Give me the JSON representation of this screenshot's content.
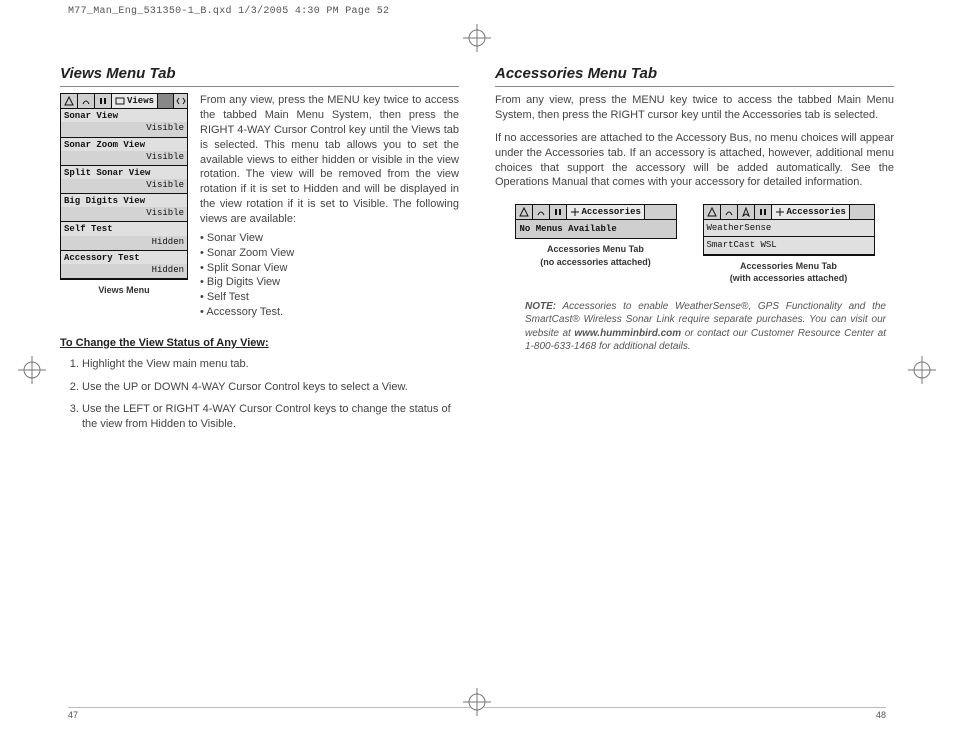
{
  "print_header": "M77_Man_Eng_531350-1_B.qxd  1/3/2005  4:30 PM  Page 52",
  "page_left": "47",
  "page_right": "48",
  "views": {
    "title": "Views Menu Tab",
    "para": "From any view, press the MENU key twice to access the tabbed Main Menu System, then press the RIGHT 4-WAY Cursor Control key until the Views tab is selected. This menu tab allows you to set the available views to either hidden or visible in the view rotation. The view will be removed from the view rotation if it is set to Hidden and will be displayed in the view rotation if it is set to Visible. The following views are available:",
    "list": [
      "Sonar View",
      "Sonar Zoom View",
      "Split Sonar View",
      "Big Digits View",
      "Self Test",
      "Accessory Test."
    ],
    "fig_caption": "Views Menu",
    "fig_tab_label": "Views",
    "fig_rows": [
      {
        "name": "Sonar View",
        "val": "Visible"
      },
      {
        "name": "Sonar Zoom View",
        "val": "Visible"
      },
      {
        "name": "Split Sonar View",
        "val": "Visible"
      },
      {
        "name": "Big Digits View",
        "val": "Visible"
      },
      {
        "name": "Self Test",
        "val": "Hidden"
      },
      {
        "name": "Accessory Test",
        "val": "Hidden"
      }
    ],
    "change_heading": "To Change the View Status of Any View:",
    "steps": [
      "Highlight the View main menu tab.",
      "Use the UP or DOWN 4-WAY Cursor Control keys to select a View.",
      "Use the LEFT or RIGHT 4-WAY Cursor Control keys to change the status of the view from Hidden to Visible."
    ]
  },
  "acc": {
    "title": "Accessories Menu Tab",
    "para1": "From any view, press the MENU key twice to access the tabbed Main Menu System, then press the RIGHT cursor key until the Accessories tab is selected.",
    "para2": "If no accessories are attached to the Accessory Bus, no menu choices will appear under the Accessories tab. If an accessory is attached, however, additional menu choices that support the accessory will be added automatically. See the Operations Manual that comes with your accessory for detailed information.",
    "fig1_tab_label": "Accessories",
    "fig1_msg": "No Menus Available",
    "fig1_caption1": "Accessories Menu Tab",
    "fig1_caption2": "(no accessories attached)",
    "fig2_tab_label": "Accessories",
    "fig2_row1": "WeatherSense",
    "fig2_row2": "SmartCast WSL",
    "fig2_caption1": "Accessories Menu Tab",
    "fig2_caption2": "(with accessories attached)",
    "note_label": "NOTE:",
    "note_text_a": " Accessories to enable WeatherSense®, GPS Functionality and the SmartCast® Wireless Sonar Link require separate purchases. You can visit our website at ",
    "note_site": "www.humminbird.com",
    "note_text_b": " or contact our Customer Resource Center at 1-800-633-1468 for additional details."
  }
}
